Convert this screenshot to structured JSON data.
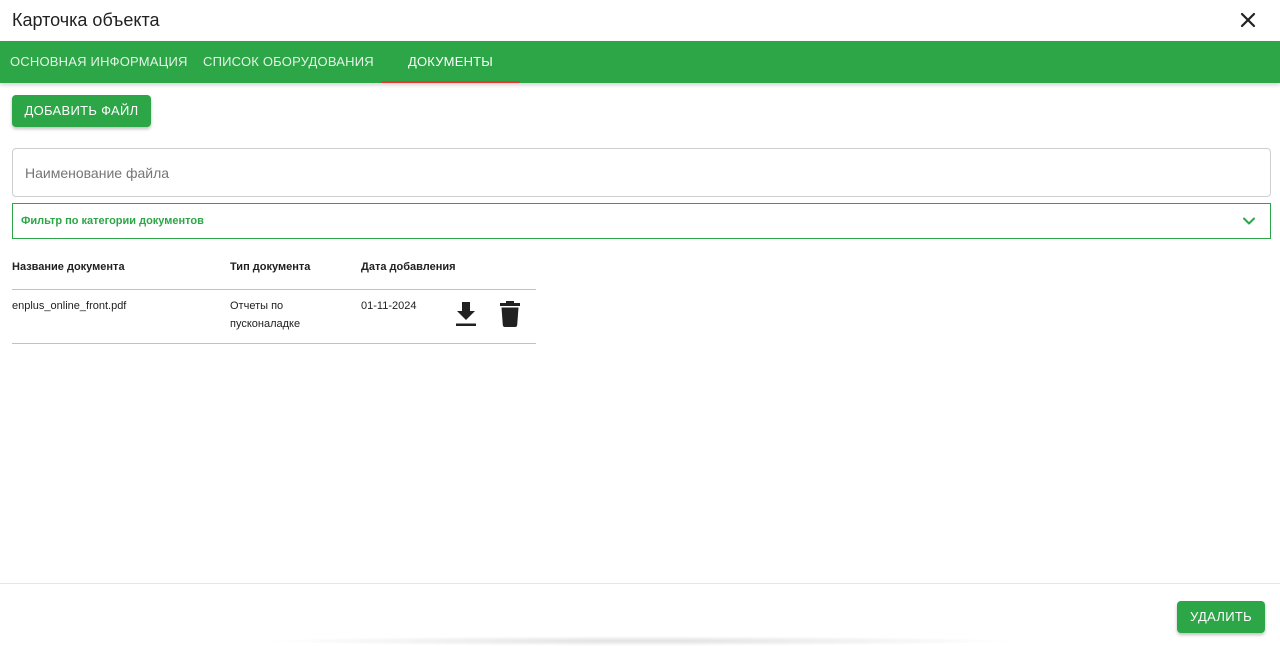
{
  "dialog": {
    "title": "Карточка объекта"
  },
  "tabs": [
    {
      "label": "ОСНОВНАЯ ИНФОРМАЦИЯ",
      "active": false
    },
    {
      "label": "СПИСОК ОБОРУДОВАНИЯ",
      "active": false
    },
    {
      "label": "ДОКУМЕНТЫ",
      "active": true
    }
  ],
  "colors": {
    "accent": "#2ca646",
    "active_tab_indicator": "#e53935",
    "table_divider": "#9fd6ac"
  },
  "toolbar": {
    "add_file_label": "ДОБАВИТЬ ФАЙЛ"
  },
  "search": {
    "placeholder": "Наименование файла",
    "value": ""
  },
  "filter": {
    "label": "Фильтр по категории документов",
    "icon": "chevron-down-icon"
  },
  "table": {
    "columns": [
      "Название документа",
      "Тип документа",
      "Дата добавления"
    ],
    "rows": [
      {
        "name": "enplus_online_front.pdf",
        "type": "Отчеты по пусконаладке",
        "date": "01-11-2024",
        "actions": [
          "download-icon",
          "trash-icon"
        ]
      }
    ]
  },
  "footer": {
    "delete_label": "УДАЛИТЬ"
  }
}
